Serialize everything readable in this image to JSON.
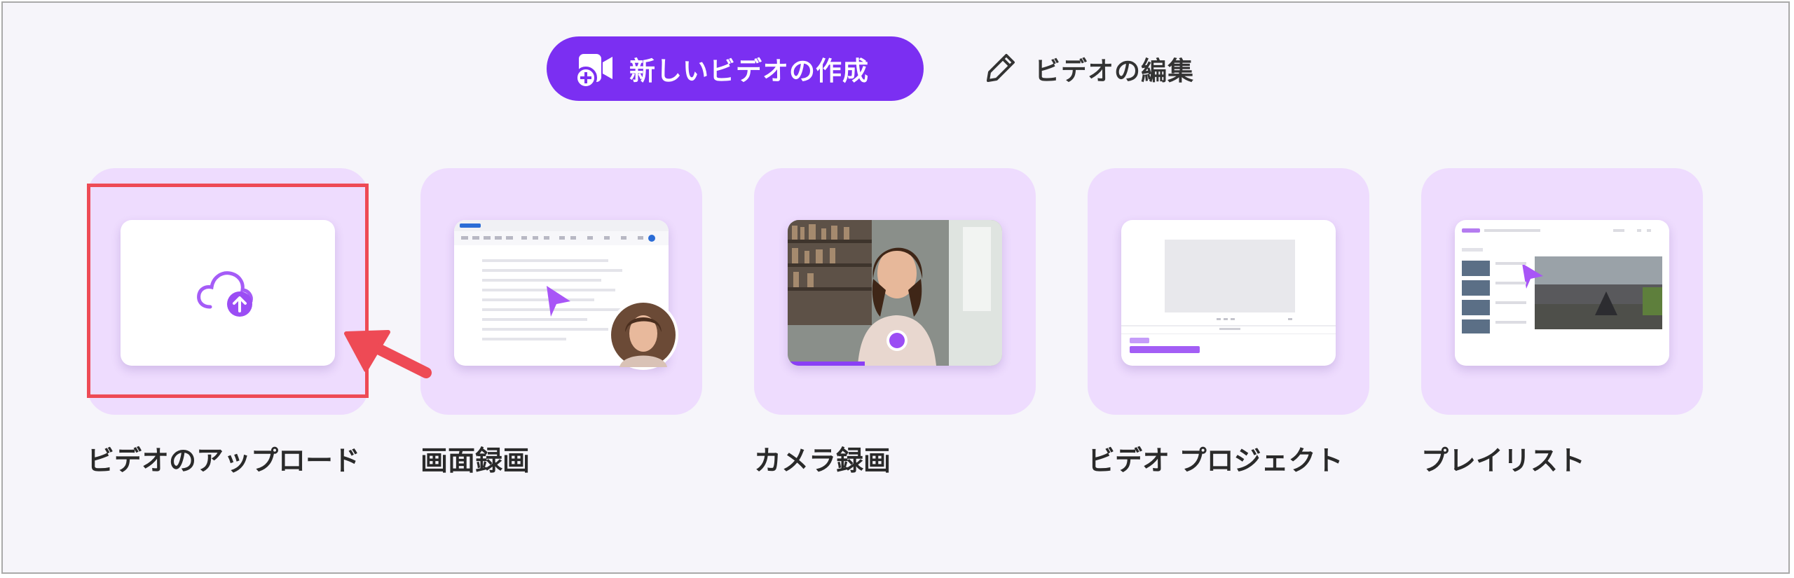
{
  "tabs": {
    "new_video": "新しいビデオの作成",
    "edit_video": "ビデオの編集"
  },
  "cards": [
    {
      "label": "ビデオのアップロード",
      "icon": "cloud-upload-icon"
    },
    {
      "label": "画面録画",
      "icon": "screen-recording-thumbnail"
    },
    {
      "label": "カメラ録画",
      "icon": "camera-recording-thumbnail"
    },
    {
      "label": "ビデオ プロジェクト",
      "icon": "video-project-thumbnail"
    },
    {
      "label": "プレイリスト",
      "icon": "playlist-thumbnail"
    }
  ],
  "colors": {
    "accent": "#7b2ff2",
    "card_bg": "#eedcfe",
    "highlight": "#ee4a55"
  }
}
